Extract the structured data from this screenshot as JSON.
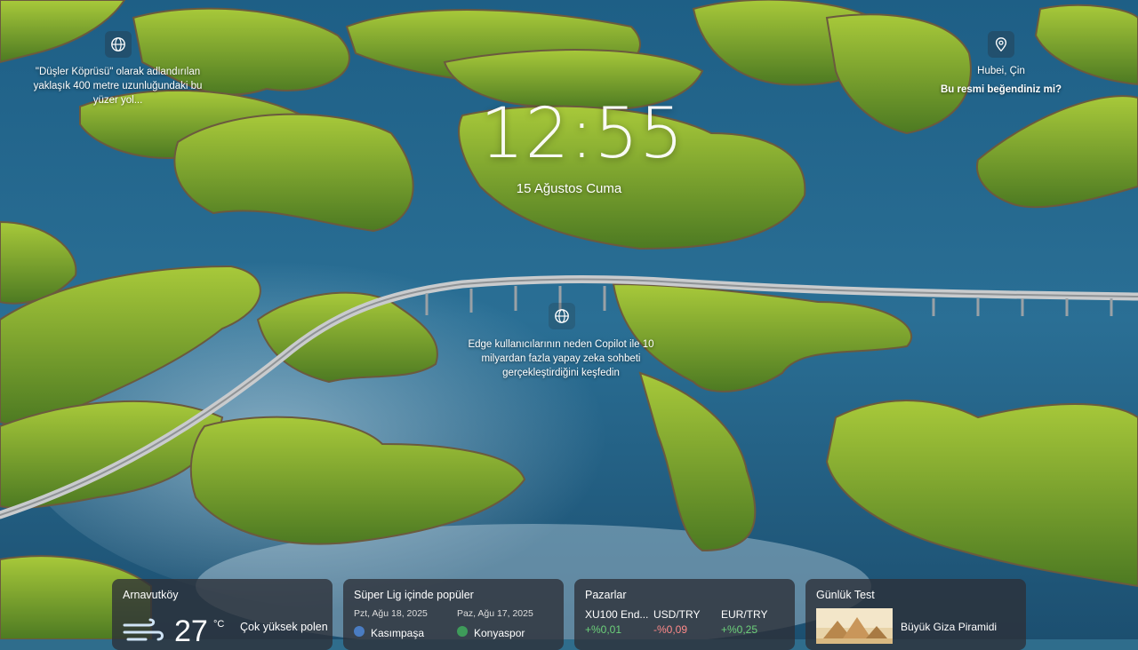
{
  "info_left": {
    "icon": "globe-icon",
    "text": "\"Düşler Köprüsü\" olarak adlandırılan\nyaklaşık 400 metre uzunluğundaki bu\nyüzer yol..."
  },
  "info_right": {
    "icon": "location-pin-icon",
    "location": "Hubei, Çin",
    "question": "Bu resmi beğendiniz mi?"
  },
  "clock": {
    "time": "12:55",
    "date": "15 Ağustos Cuma"
  },
  "info_center": {
    "icon": "globe-icon",
    "text": "Edge kullanıcılarının neden Copilot ile 10\nmilyardan fazla yapay zeka sohbeti\ngerçekleştirdiğini keşfedin"
  },
  "widgets": {
    "weather": {
      "location": "Arnavutköy",
      "temp": "27",
      "unit": "°C",
      "desc": "Çok yüksek polen",
      "icon": "wind-icon"
    },
    "sports": {
      "title": "Süper Lig içinde popüler",
      "match1": {
        "date": "Pzt, Ağu 18, 2025",
        "team": "Kasımpaşa"
      },
      "match2": {
        "date": "Paz, Ağu 17, 2025",
        "team": "Konyaspor"
      }
    },
    "markets": {
      "title": "Pazarlar",
      "tickers": [
        {
          "name": "XU100 End...",
          "change": "+%0,01"
        },
        {
          "name": "USD/TRY",
          "change": "-%0,09"
        },
        {
          "name": "EUR/TRY",
          "change": "+%0,25"
        }
      ]
    },
    "daily_test": {
      "title": "Günlük Test",
      "text": "Büyük Giza Piramidi"
    }
  }
}
